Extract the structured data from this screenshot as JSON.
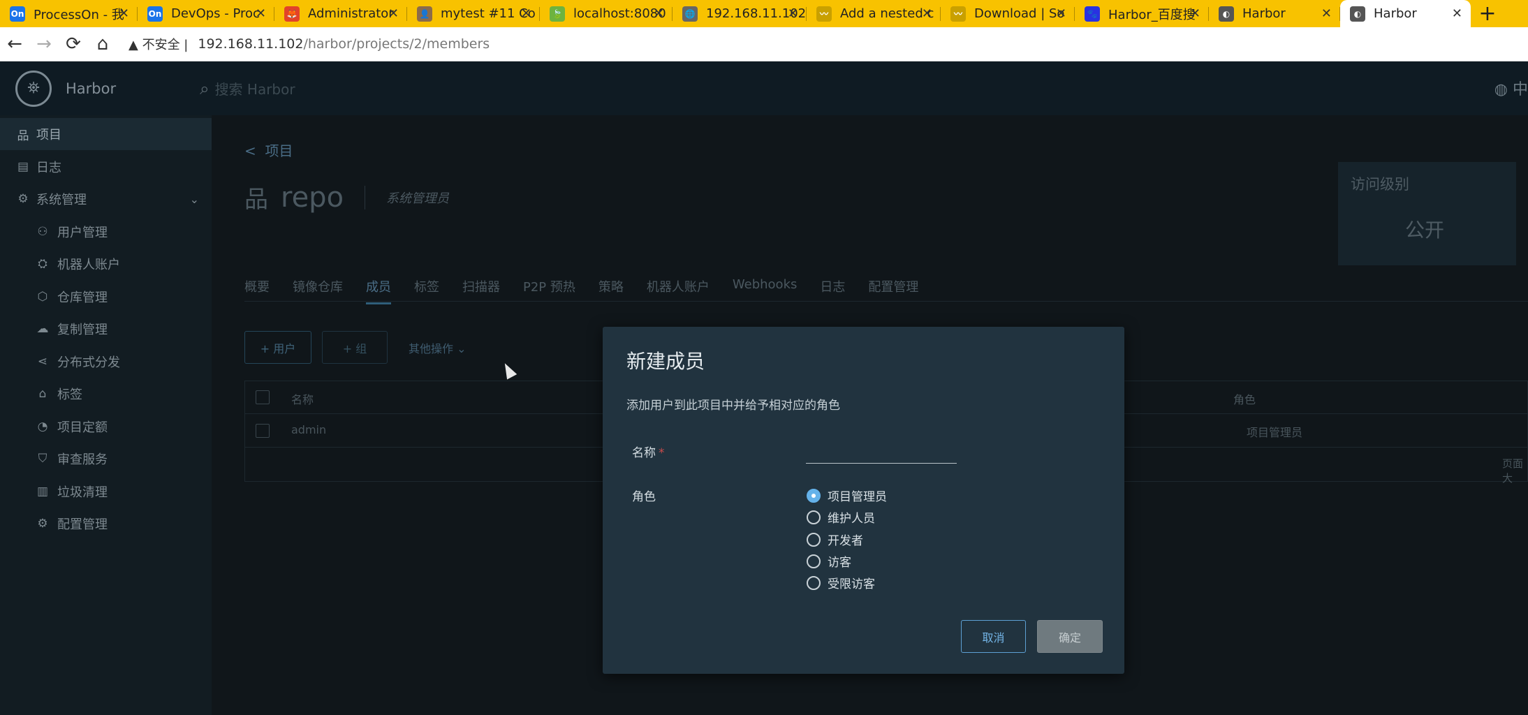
{
  "browser": {
    "tabs": [
      {
        "title": "ProcessOn - 我",
        "favicon": "On",
        "color": "#1a73e8"
      },
      {
        "title": "DevOps - Proc",
        "favicon": "On",
        "color": "#1a73e8"
      },
      {
        "title": "Administrator",
        "favicon": "🦊",
        "color": "#e24329"
      },
      {
        "title": "mytest #11 Co",
        "favicon": "👤",
        "color": "#8b6b4a"
      },
      {
        "title": "localhost:8080",
        "favicon": "🍃",
        "color": "#6db33f"
      },
      {
        "title": "192.168.11.102",
        "favicon": "🌐",
        "color": "#666"
      },
      {
        "title": "Add a nested c",
        "favicon": "〰",
        "color": "#c9a000"
      },
      {
        "title": "Download | So",
        "favicon": "〰",
        "color": "#c9a000"
      },
      {
        "title": "Harbor_百度搜",
        "favicon": "🐾",
        "color": "#2932e1"
      },
      {
        "title": "Harbor",
        "favicon": "◐",
        "color": "#555"
      },
      {
        "title": "Harbor",
        "favicon": "◐",
        "color": "#555",
        "active": true
      }
    ],
    "security_label": "不安全",
    "url_host": "192.168.11.102",
    "url_path": "/harbor/projects/2/members"
  },
  "header": {
    "brand": "Harbor",
    "search_placeholder": "搜索 Harbor",
    "lang": "中"
  },
  "sidebar": {
    "items": [
      {
        "label": "项目",
        "icon": "project-icon",
        "glyph": "品",
        "active": true,
        "sub": false
      },
      {
        "label": "日志",
        "icon": "log-icon",
        "glyph": "▤",
        "sub": false
      },
      {
        "label": "系统管理",
        "icon": "admin-icon",
        "glyph": "⚙",
        "sub": false,
        "expand": true
      },
      {
        "label": "用户管理",
        "icon": "users-icon",
        "glyph": "⚇",
        "sub": true
      },
      {
        "label": "机器人账户",
        "icon": "robot-icon",
        "glyph": "⛭",
        "sub": true
      },
      {
        "label": "仓库管理",
        "icon": "registry-icon",
        "glyph": "⬡",
        "sub": true
      },
      {
        "label": "复制管理",
        "icon": "replication-icon",
        "glyph": "☁",
        "sub": true
      },
      {
        "label": "分布式分发",
        "icon": "distribution-icon",
        "glyph": "⋖",
        "sub": true
      },
      {
        "label": "标签",
        "icon": "tag-icon",
        "glyph": "⌂",
        "sub": true
      },
      {
        "label": "项目定额",
        "icon": "quota-icon",
        "glyph": "◔",
        "sub": true
      },
      {
        "label": "审查服务",
        "icon": "shield-icon",
        "glyph": "⛉",
        "sub": true
      },
      {
        "label": "垃圾清理",
        "icon": "trash-icon",
        "glyph": "▥",
        "sub": true
      },
      {
        "label": "配置管理",
        "icon": "config-icon",
        "glyph": "⚙",
        "sub": true
      }
    ]
  },
  "main": {
    "back_label": "项目",
    "project_name": "repo",
    "role_label": "系统管理员",
    "access_level_label": "访问级别",
    "access_level_value": "公开",
    "tabs": [
      "概要",
      "镜像仓库",
      "成员",
      "标签",
      "扫描器",
      "P2P 预热",
      "策略",
      "机器人账户",
      "Webhooks",
      "日志",
      "配置管理"
    ],
    "active_tab": "成员",
    "add_user_label": "+ 用户",
    "add_group_label": "+ 组",
    "more_ops_label": "其他操作 ⌄",
    "table": {
      "col_name": "名称",
      "col_role": "角色",
      "rows": [
        {
          "name": "admin",
          "role": "项目管理员"
        }
      ],
      "footer": "页面大"
    }
  },
  "modal": {
    "title": "新建成员",
    "subtitle": "添加用户到此项目中并给予相对应的角色",
    "name_label": "名称",
    "role_label": "角色",
    "roles": [
      "项目管理员",
      "维护人员",
      "开发者",
      "访客",
      "受限访客"
    ],
    "selected_role": "项目管理员",
    "cancel_label": "取消",
    "ok_label": "确定"
  }
}
